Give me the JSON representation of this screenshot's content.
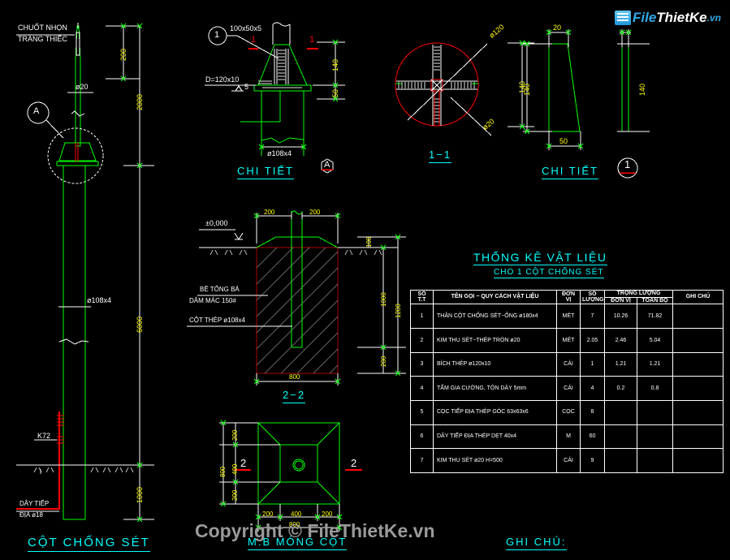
{
  "drawing": {
    "background_color": "#000000",
    "title_color": "#00ffff",
    "dim_color": "#ffff00",
    "object_color": "#00ff00",
    "section_color": "#ff0000"
  },
  "views": {
    "column": {
      "title": "CỘT CHỐNG SÉT",
      "labels": {
        "tip_note_line1": "CHUỐT NHỌN",
        "tip_note_line2": "TRÁNG THIẾC",
        "rod_dia": "ø20",
        "pipe_dia": "ø108x4",
        "weld_mark": "K72",
        "ground_wire_line1": "DÂY TIẾP",
        "ground_wire_line2": "ĐỊA ø18",
        "detail_bubble": "A"
      },
      "dims": {
        "tip": "200",
        "upper": "2000",
        "body": "6000",
        "buried": "1000"
      }
    },
    "detail_head": {
      "title": "CHI TIẾT",
      "bubble": "1",
      "labels": {
        "plate_spec": "100x50x5",
        "flange_spec": "D=120x10",
        "weld_symbol": "5",
        "pipe_dia": "ø108x4"
      },
      "section_marks": [
        "1",
        "1"
      ],
      "dims": {
        "height": "140",
        "flange": "50"
      },
      "detail_tag": "A"
    },
    "section_1_1": {
      "title": "1−1",
      "labels": {
        "plate_dia": "ø120",
        "rod_dia": "ø20"
      },
      "dims": {
        "height": "140"
      }
    },
    "detail_rib": {
      "title": "CHI TIẾT",
      "bubble": "1",
      "dims": {
        "top": "20",
        "height_left": "140",
        "bottom": "50",
        "height_right": "140"
      }
    },
    "section_2_2": {
      "title": "2−2",
      "labels": {
        "level": "±0,000",
        "concrete_line1": "BÊ TÔNG BÁ",
        "concrete_line2": "DĂM MÁC 150#",
        "column_steel": "CỘT THÉP ø108x4"
      },
      "dims": {
        "left_offset": "200",
        "right_offset": "200",
        "cap": "100",
        "depth": "1000",
        "total_depth": "1200",
        "bottom": "200",
        "width": "800"
      }
    },
    "foundation_plan": {
      "title": "M.B MÓNG CỘT",
      "section_marks": [
        "2",
        "2"
      ],
      "dims": {
        "top_left": "200",
        "mid": "400",
        "top_right": "200",
        "width": "800",
        "v_top": "200",
        "v_mid": "400",
        "v_bottom": "200",
        "height": "800"
      }
    }
  },
  "material_table": {
    "title": "THỐNG KÊ VẬT LIỆU",
    "subtitle": "CHO 1 CỘT CHỐNG SÉT",
    "headers": {
      "no_line1": "SỐ",
      "no_line2": "T.T",
      "name": "TÊN GỌI − QUY CÁCH VẬT LIỆU",
      "unit_line1": "ĐƠN",
      "unit_line2": "VỊ",
      "qty_line1": "SỐ",
      "qty_line2": "LƯỢNG",
      "weight_group": "TRỌNG LƯỢNG",
      "weight_unit": "ĐƠN VỊ",
      "weight_total": "TOÀN BỘ",
      "note": "GHI CHÚ"
    },
    "rows": [
      {
        "no": "1",
        "name": "THÂN CỘT CHỐNG SÉT−ỐNG ø180x4",
        "unit": "MÉT",
        "qty": "7",
        "w_unit": "10.26",
        "w_total": "71.82",
        "note": ""
      },
      {
        "no": "2",
        "name": "KIM THU SÉT−THÉP TRÒN ø20",
        "unit": "MÉT",
        "qty": "2.05",
        "w_unit": "2.46",
        "w_total": "5.04",
        "note": ""
      },
      {
        "no": "3",
        "name": "BÍCH THÉP ø120x10",
        "unit": "CÁI",
        "qty": "1",
        "w_unit": "1.21",
        "w_total": "1.21",
        "note": ""
      },
      {
        "no": "4",
        "name": "TẤM GIA CƯỜNG, TÔN DÀY 5mm",
        "unit": "CÁI",
        "qty": "4",
        "w_unit": "0.2",
        "w_total": "0.8",
        "note": ""
      },
      {
        "no": "5",
        "name": "CỌC TIẾP ĐỊA THÉP GÓC 63x63x6",
        "unit": "CỌC",
        "qty": "8",
        "w_unit": "",
        "w_total": "",
        "note": ""
      },
      {
        "no": "6",
        "name": "DÂY TIẾP ĐỊA THÉP DẸT 40x4",
        "unit": "M",
        "qty": "60",
        "w_unit": "",
        "w_total": "",
        "note": ""
      },
      {
        "no": "7",
        "name": "KIM THU SÉT ø20 H=500",
        "unit": "CÁI",
        "qty": "9",
        "w_unit": "",
        "w_total": "",
        "note": ""
      }
    ]
  },
  "notes": {
    "title": "GHI CHÚ:"
  },
  "watermark": {
    "logo_part1": "File",
    "logo_part2": "Thiet",
    "logo_part3": "Ke",
    "logo_part4": ".vn",
    "copyright": "Copyright © FileThietKe.vn"
  }
}
